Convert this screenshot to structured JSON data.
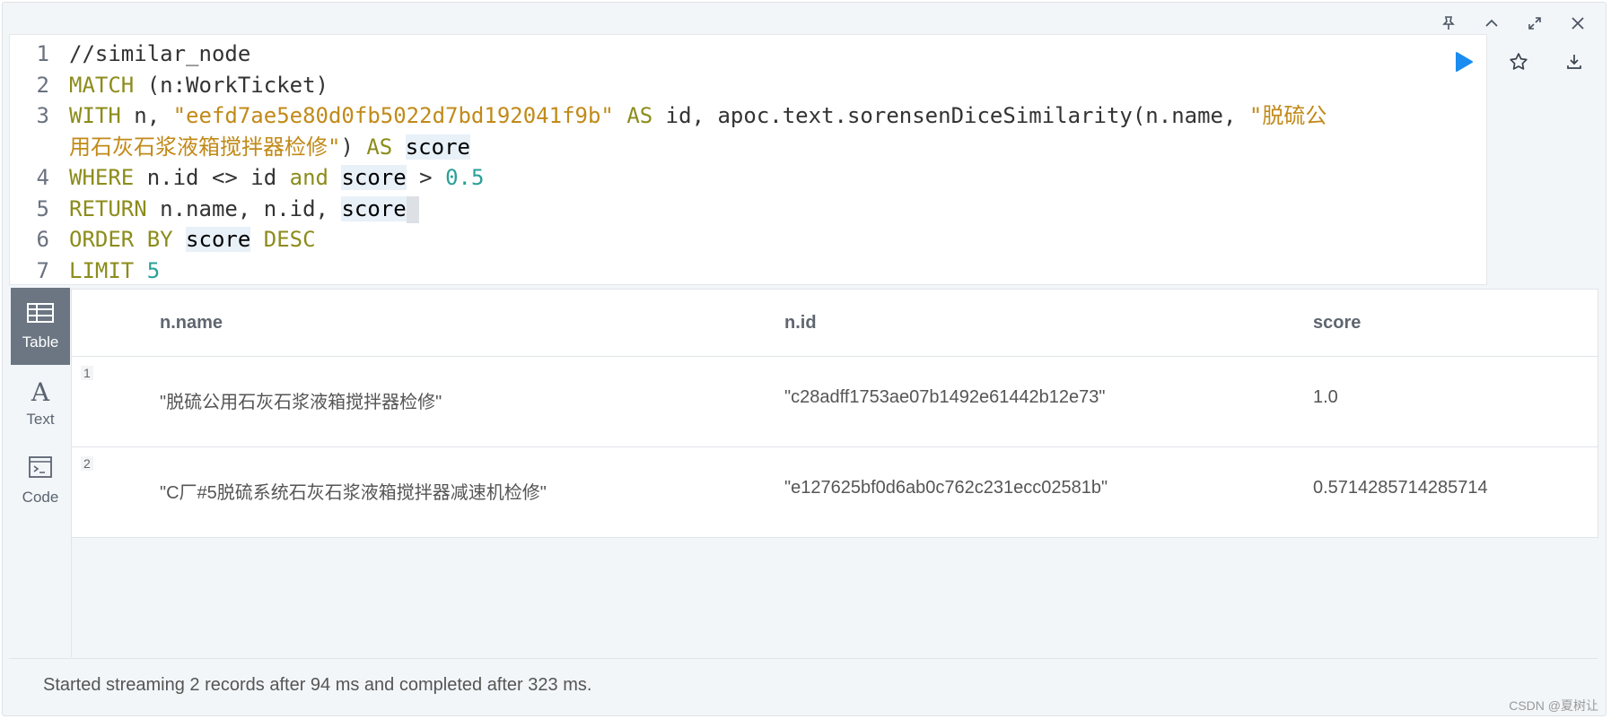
{
  "window_icons": [
    "pin-icon",
    "collapse-icon",
    "expand-icon",
    "close-icon"
  ],
  "editor": {
    "lines": [
      {
        "n": "1",
        "tokens": [
          [
            "//similar_node",
            "txt"
          ]
        ]
      },
      {
        "n": "2",
        "tokens": [
          [
            "MATCH",
            "k"
          ],
          [
            " (n:WorkTicket)",
            "txt"
          ]
        ]
      },
      {
        "n": "3",
        "tokens": [
          [
            "WITH",
            "k"
          ],
          [
            " n, ",
            "txt"
          ],
          [
            "\"eefd7ae5e80d0fb5022d7bd192041f9b\"",
            "s"
          ],
          [
            " ",
            "txt"
          ],
          [
            "AS",
            "k"
          ],
          [
            " id, apoc.text.sorensenDiceSimilarity(n.name, ",
            "txt"
          ],
          [
            "\"脱硫公",
            "s"
          ]
        ]
      },
      {
        "n": "",
        "tokens": [
          [
            "用石灰石浆液箱搅拌器检修\"",
            "s"
          ],
          [
            ") ",
            "txt"
          ],
          [
            "AS",
            "k"
          ],
          [
            " ",
            "txt"
          ],
          [
            "score",
            "hl"
          ]
        ]
      },
      {
        "n": "4",
        "tokens": [
          [
            "WHERE",
            "k"
          ],
          [
            " n.id <> id ",
            "txt"
          ],
          [
            "and",
            "k"
          ],
          [
            " ",
            "txt"
          ],
          [
            "score",
            "hl"
          ],
          [
            " > ",
            "txt"
          ],
          [
            "0.5",
            "n"
          ]
        ]
      },
      {
        "n": "5",
        "tokens": [
          [
            "RETURN",
            "k"
          ],
          [
            " n.name, n.id, ",
            "txt"
          ],
          [
            "score",
            "hl"
          ],
          [
            "",
            "cursor"
          ]
        ]
      },
      {
        "n": "6",
        "tokens": [
          [
            "ORDER BY",
            "k"
          ],
          [
            " ",
            "txt"
          ],
          [
            "score",
            "hl"
          ],
          [
            " ",
            "txt"
          ],
          [
            "DESC",
            "k"
          ]
        ]
      },
      {
        "n": "7",
        "tokens": [
          [
            "LIMIT",
            "k"
          ],
          [
            " ",
            "txt"
          ],
          [
            "5",
            "n"
          ]
        ]
      }
    ]
  },
  "toolbar": {
    "run": "run-icon",
    "favorite": "star-icon",
    "download": "download-icon"
  },
  "sidebar": {
    "items": [
      {
        "label": "Table",
        "icon": "table-icon",
        "active": true
      },
      {
        "label": "Text",
        "icon": "text-icon",
        "active": false
      },
      {
        "label": "Code",
        "icon": "code-icon",
        "active": false
      }
    ]
  },
  "table": {
    "headers": [
      "n.name",
      "n.id",
      "score"
    ],
    "rows": [
      {
        "num": "1",
        "cells": [
          "\"脱硫公用石灰石浆液箱搅拌器检修\"",
          "\"c28adff1753ae07b1492e61442b12e73\"",
          "1.0"
        ]
      },
      {
        "num": "2",
        "cells": [
          "\"C厂#5脱硫系统石灰石浆液箱搅拌器减速机检修\"",
          "\"e127625bf0d6ab0c762c231ecc02581b\"",
          "0.5714285714285714"
        ]
      }
    ]
  },
  "status": "Started streaming 2 records after 94 ms and completed after 323 ms.",
  "watermark": "CSDN @夏树让"
}
